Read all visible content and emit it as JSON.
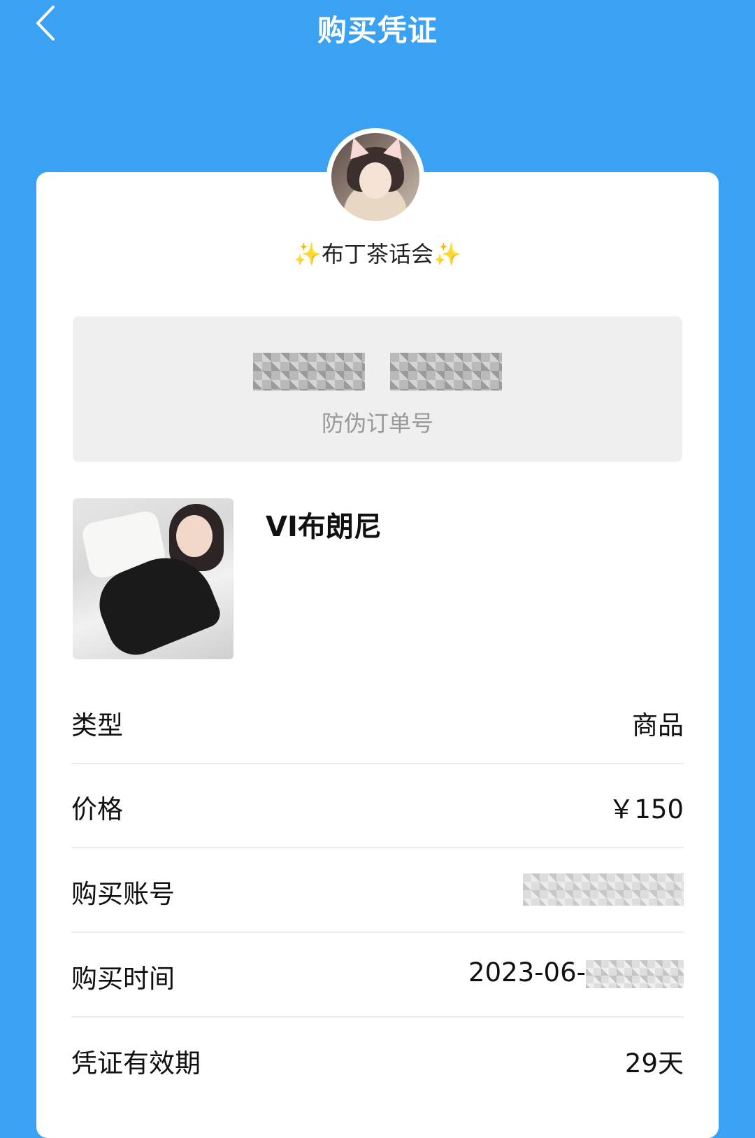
{
  "header": {
    "title": "购买凭证",
    "back_icon": "chevron-left-icon"
  },
  "shop": {
    "sparkle_left": "✨",
    "name": "布丁茶话会",
    "sparkle_right": "✨"
  },
  "order": {
    "label": "防伪订单号"
  },
  "product": {
    "name": "VI布朗尼"
  },
  "details": [
    {
      "label": "类型",
      "value": "商品"
    },
    {
      "label": "价格",
      "value": "￥150"
    },
    {
      "label": "购买账号",
      "value": ""
    },
    {
      "label": "购买时间",
      "value": "2023-06-"
    },
    {
      "label": "凭证有效期",
      "value": "29天"
    }
  ],
  "colors": {
    "header_bg": "#3ba1f3",
    "card_bg": "#ffffff",
    "order_box_bg": "#efefef",
    "sparkle": "#f6c31c"
  }
}
